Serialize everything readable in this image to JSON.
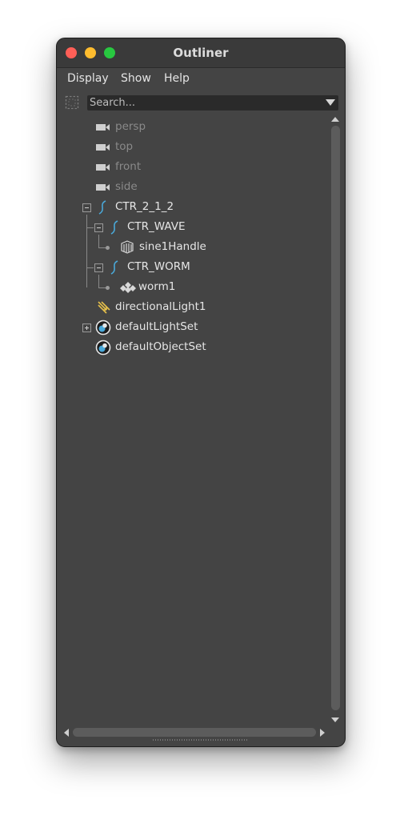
{
  "window": {
    "title": "Outliner"
  },
  "menubar": {
    "items": [
      "Display",
      "Show",
      "Help"
    ]
  },
  "search": {
    "placeholder": "Search..."
  },
  "outliner": {
    "items": [
      {
        "label": "persp",
        "icon": "camera-icon",
        "dimmed": true
      },
      {
        "label": "top",
        "icon": "camera-icon",
        "dimmed": true
      },
      {
        "label": "front",
        "icon": "camera-icon",
        "dimmed": true
      },
      {
        "label": "side",
        "icon": "camera-icon",
        "dimmed": true
      },
      {
        "label": "CTR_2_1_2",
        "icon": "curve-icon",
        "expanded": true
      },
      {
        "label": "CTR_WAVE",
        "icon": "curve-icon",
        "expanded": true
      },
      {
        "label": "sine1Handle",
        "icon": "deformer-handle-icon"
      },
      {
        "label": "CTR_WORM",
        "icon": "curve-icon",
        "expanded": true
      },
      {
        "label": "worm1",
        "icon": "diamond-cluster-icon"
      },
      {
        "label": "directionalLight1",
        "icon": "directional-light-icon"
      },
      {
        "label": "defaultLightSet",
        "icon": "set-icon",
        "expanded": false
      },
      {
        "label": "defaultObjectSet",
        "icon": "set-icon"
      }
    ]
  },
  "colors": {
    "window_bg": "#444444",
    "titlebar_bg": "#3a3a3a",
    "search_bg": "#2a2a2a",
    "text": "#e6e6e6",
    "dim_text": "#8a8a8a",
    "curve_blue": "#4aa8d8",
    "light_yellow": "#e8c14a",
    "close_red": "#ff5f57",
    "minimize_yellow": "#febc2e",
    "zoom_green": "#28c840"
  }
}
